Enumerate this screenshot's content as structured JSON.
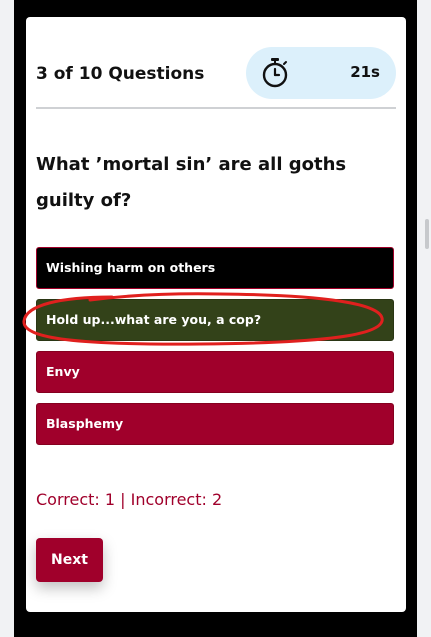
{
  "quiz": {
    "progress_text": "3 of 10 Questions",
    "timer": {
      "icon": "stopwatch-icon",
      "value": "21s"
    },
    "question": "What ’mortal sin’ are all goths guilty of?",
    "options": [
      {
        "label": "Wishing harm on others",
        "state": "default"
      },
      {
        "label": "Hold up...what are you, a cop?",
        "state": "selected"
      },
      {
        "label": "Envy",
        "state": "default"
      },
      {
        "label": "Blasphemy",
        "state": "default"
      }
    ],
    "score_text": "Correct: 1 | Incorrect: 2",
    "next_label": "Next"
  },
  "colors": {
    "accent": "#a0002b",
    "selected": "#334219",
    "timer_bg": "#dcf0fb",
    "annotation": "#e0201e"
  }
}
